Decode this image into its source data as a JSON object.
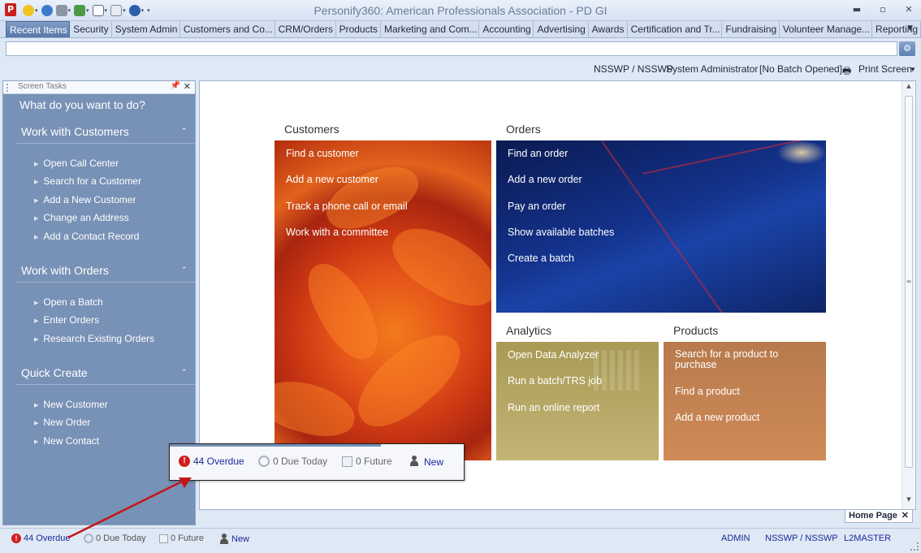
{
  "window": {
    "title": "Personify360: American Professionals Association - PD GI",
    "logo_letter": "P"
  },
  "menu": {
    "tabs": [
      {
        "label": "Recent Items",
        "active": true
      },
      {
        "label": "Security"
      },
      {
        "label": "System Admin"
      },
      {
        "label": "Customers and Co..."
      },
      {
        "label": "CRM/Orders"
      },
      {
        "label": "Products"
      },
      {
        "label": "Marketing and Com..."
      },
      {
        "label": "Accounting"
      },
      {
        "label": "Advertising"
      },
      {
        "label": "Awards"
      },
      {
        "label": "Certification and Tr..."
      },
      {
        "label": "Fundraising"
      },
      {
        "label": "Volunteer Manage..."
      },
      {
        "label": "Reporting"
      }
    ]
  },
  "address": {
    "value": ""
  },
  "info": {
    "org": "NSSWP / NSSWP",
    "role": "System Administrator",
    "batch": "[No Batch Opened]",
    "print": "Print Screen"
  },
  "taskpane": {
    "title": "Screen Tasks",
    "heading": "What do you want to do?",
    "groups": [
      {
        "title": "Work with Customers",
        "items": [
          "Open Call Center",
          "Search for a Customer",
          "Add a New Customer",
          "Change an Address",
          "Add a Contact Record"
        ]
      },
      {
        "title": "Work with Orders",
        "items": [
          "Open a Batch",
          "Enter Orders",
          "Research Existing Orders"
        ]
      },
      {
        "title": "Quick Create",
        "items": [
          "New Customer",
          "New Order",
          "New Contact"
        ]
      }
    ]
  },
  "tiles": {
    "customers": {
      "title": "Customers",
      "links": [
        "Find a customer",
        "Add a new customer",
        "Track a phone call or email",
        "Work with a committee"
      ]
    },
    "orders": {
      "title": "Orders",
      "links": [
        "Find an order",
        "Add a new order",
        "Pay an order",
        "Show available batches",
        "Create a batch"
      ]
    },
    "analytics": {
      "title": "Analytics",
      "links": [
        "Open Data Analyzer",
        "Run a batch/TRS job",
        "Run an online report"
      ]
    },
    "products": {
      "title": "Products",
      "links": [
        "Search for a product to purchase",
        "Find a product",
        "Add a new product"
      ]
    }
  },
  "home_tab": {
    "label": "Home Page"
  },
  "status": {
    "overdue": "44 Overdue",
    "due_today": "0 Due Today",
    "future": "0 Future",
    "new": "New",
    "user": "ADMIN",
    "org": "NSSWP / NSSWP",
    "server": "L2MASTER"
  },
  "callout": {
    "overdue": "44 Overdue",
    "due_today": "0 Due Today",
    "future": "0 Future",
    "new": "New"
  },
  "colors": {
    "overdue_text": "#1a2a9a",
    "arrow": "#c01818"
  }
}
